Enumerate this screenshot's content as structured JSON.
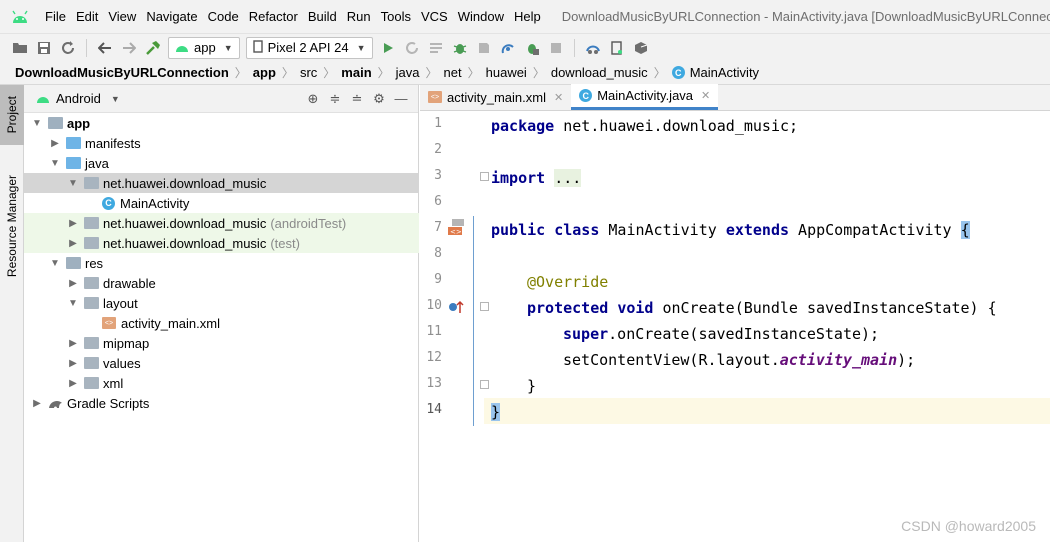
{
  "menubar": {
    "items": [
      "File",
      "Edit",
      "View",
      "Navigate",
      "Code",
      "Refactor",
      "Build",
      "Run",
      "Tools",
      "VCS",
      "Window",
      "Help"
    ],
    "window_title": "DownloadMusicByURLConnection - MainActivity.java [DownloadMusicByURLConnection.app]"
  },
  "toolbar": {
    "module_combo": "app",
    "device_combo": "Pixel 2 API 24"
  },
  "breadcrumb": {
    "items": [
      "DownloadMusicByURLConnection",
      "app",
      "src",
      "main",
      "java",
      "net",
      "huawei",
      "download_music",
      "MainActivity"
    ]
  },
  "side_strip": {
    "project_tab": "Project",
    "resource_manager_tab": "Resource Manager"
  },
  "project_panel": {
    "view_mode": "Android",
    "tree": [
      {
        "label": "app",
        "extra": ""
      },
      {
        "label": "manifests",
        "extra": ""
      },
      {
        "label": "java",
        "extra": ""
      },
      {
        "label": "net.huawei.download_music",
        "extra": ""
      },
      {
        "label": "MainActivity",
        "extra": ""
      },
      {
        "label": "net.huawei.download_music",
        "extra": "(androidTest)"
      },
      {
        "label": "net.huawei.download_music",
        "extra": "(test)"
      },
      {
        "label": "res",
        "extra": ""
      },
      {
        "label": "drawable",
        "extra": ""
      },
      {
        "label": "layout",
        "extra": ""
      },
      {
        "label": "activity_main.xml",
        "extra": ""
      },
      {
        "label": "mipmap",
        "extra": ""
      },
      {
        "label": "values",
        "extra": ""
      },
      {
        "label": "xml",
        "extra": ""
      },
      {
        "label": "Gradle Scripts",
        "extra": ""
      }
    ]
  },
  "editor": {
    "tabs": [
      "activity_main.xml",
      "MainActivity.java"
    ],
    "line_numbers": [
      "1",
      "2",
      "3",
      "6",
      "7",
      "8",
      "9",
      "10",
      "11",
      "12",
      "13",
      "14"
    ],
    "code": {
      "l1_kw": "package",
      "l1_rest": " net.huawei.download_music;",
      "l3_kw": "import",
      "l3_fold": "...",
      "l7_kw1": "public",
      "l7_kw2": "class",
      "l7_name": " MainActivity ",
      "l7_kw3": "extends",
      "l7_rest": " AppCompatActivity ",
      "l7_brace": "{",
      "l9_ann": "@Override",
      "l10_kw1": "protected",
      "l10_kw2": "void",
      "l10_rest": " onCreate(Bundle savedInstanceState) {",
      "l11_kw": "super",
      "l11_rest": ".onCreate(savedInstanceState);",
      "l12_pre": "setContentView(R.layout.",
      "l12_field": "activity_main",
      "l12_post": ");",
      "l13": "}",
      "l14": "}"
    }
  },
  "watermark": "CSDN @howard2005"
}
